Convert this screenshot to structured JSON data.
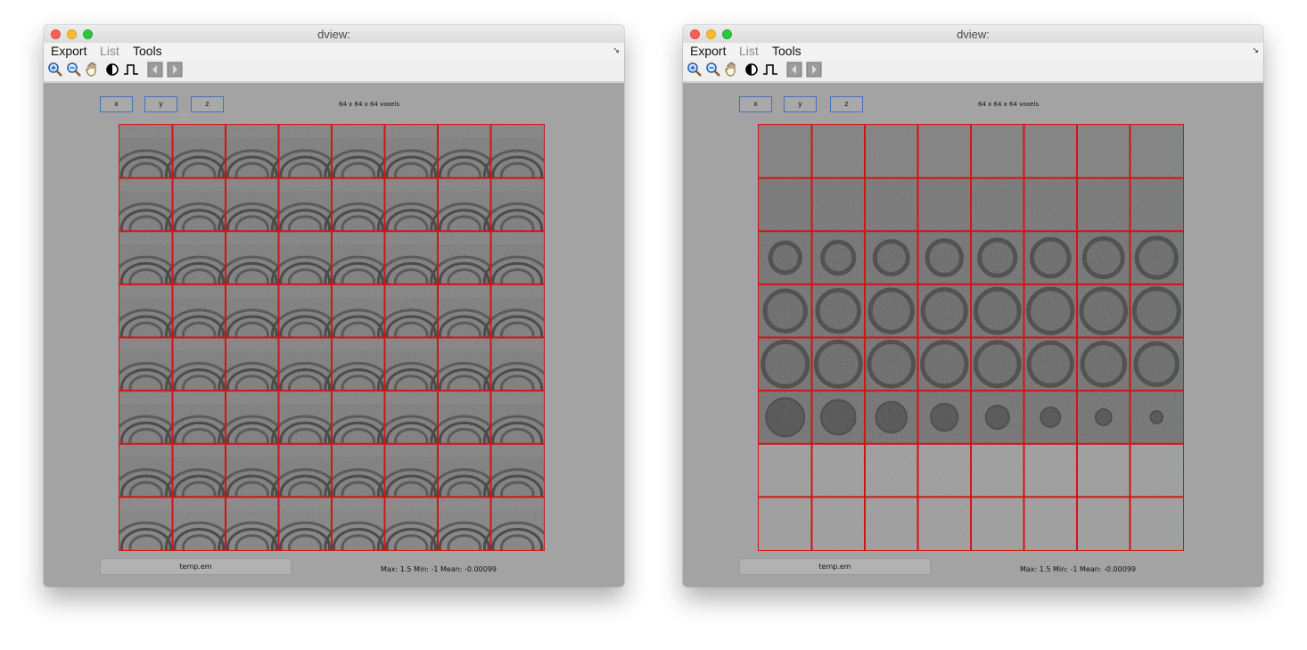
{
  "windows": [
    {
      "id": "left",
      "title": "dview:",
      "menu": {
        "export": "Export",
        "list": "List",
        "tools": "Tools"
      },
      "toolbar": [
        "zoom-in-icon",
        "zoom-out-icon",
        "pan-hand-icon",
        "contrast-icon",
        "pulse-icon",
        "previous-arrow-icon",
        "next-arrow-icon"
      ],
      "axis_buttons": {
        "x": "x",
        "y": "y",
        "z": "z"
      },
      "dimensions": "64 x 64 x 64 voxels",
      "montage": {
        "rows": 8,
        "cols": 8,
        "view": "side",
        "grid_color": "#d01515"
      },
      "filename": "temp.em",
      "stats": "Max:   1.5 Min:   -1 Mean: -0.00099"
    },
    {
      "id": "right",
      "title": "dview:",
      "menu": {
        "export": "Export",
        "list": "List",
        "tools": "Tools"
      },
      "toolbar": [
        "zoom-in-icon",
        "zoom-out-icon",
        "pan-hand-icon",
        "contrast-icon",
        "pulse-icon",
        "previous-arrow-icon",
        "next-arrow-icon"
      ],
      "axis_buttons": {
        "x": "x",
        "y": "y",
        "z": "z"
      },
      "dimensions": "64 x 64 x 64 voxels",
      "montage": {
        "rows": 8,
        "cols": 8,
        "view": "sphere",
        "grid_color": "#d01515"
      },
      "filename": "temp.em",
      "stats": "Max:   1.5 Min:   -1 Mean: -0.00099"
    }
  ]
}
